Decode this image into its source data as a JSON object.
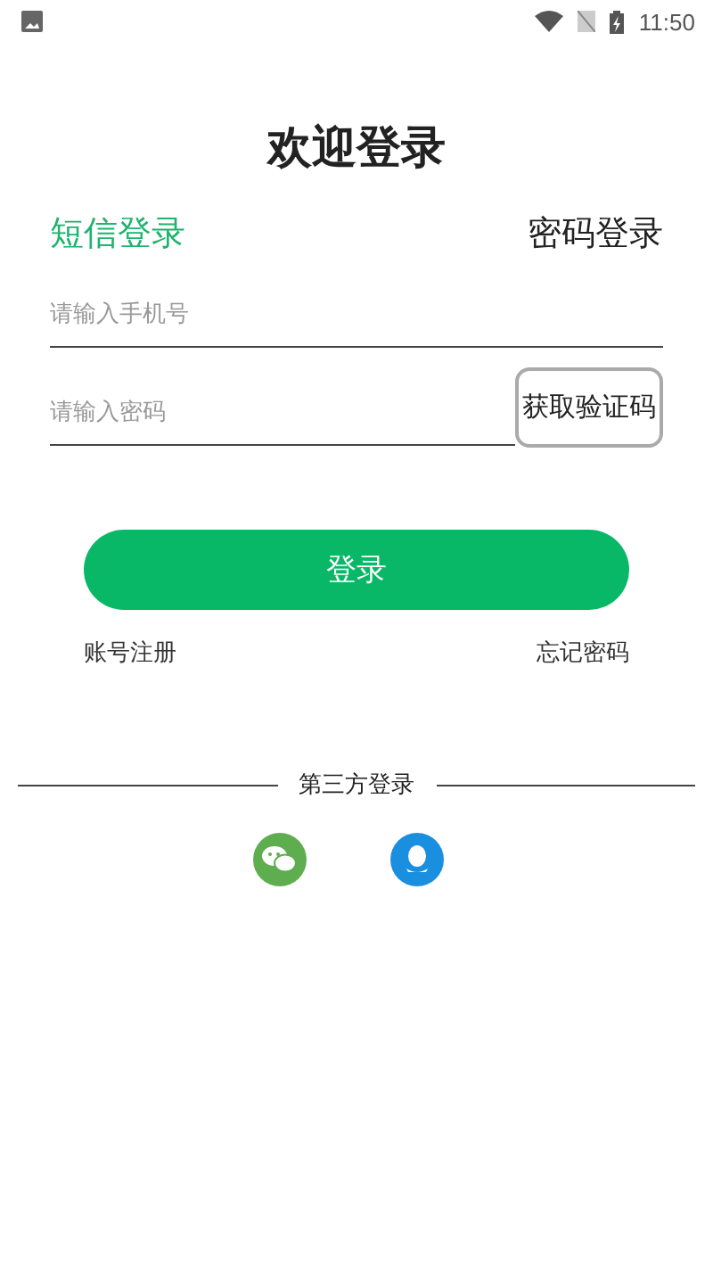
{
  "status_bar": {
    "time": "11:50"
  },
  "title": "欢迎登录",
  "tabs": [
    {
      "label": "短信登录",
      "selected": true
    },
    {
      "label": "密码登录",
      "selected": false
    }
  ],
  "phone_field": {
    "placeholder": "请输入手机号"
  },
  "code_field": {
    "placeholder": "请输入密码"
  },
  "code_button": "获取验证码",
  "login_button": "登录",
  "links": [
    "账号注册",
    "忘记密码"
  ],
  "third_party": {
    "label": "第三方登录",
    "providers": [
      {
        "kind": "wechat"
      },
      {
        "kind": "qq"
      }
    ]
  }
}
